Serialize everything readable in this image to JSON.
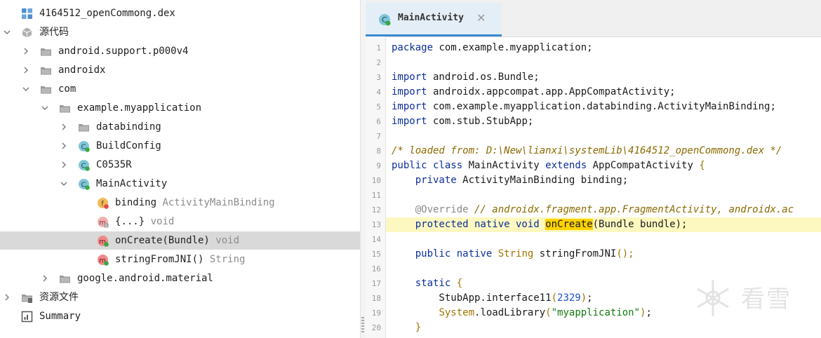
{
  "tree": {
    "items": [
      {
        "label": "4164512_openCommong.dex",
        "type": "",
        "icon": "dex-file-icon",
        "depth": 0,
        "expand": "none",
        "selected": false
      },
      {
        "label": "源代码",
        "type": "",
        "icon": "package-cube-icon",
        "depth": 0,
        "expand": "expanded",
        "selected": false
      },
      {
        "label": "android.support.p000v4",
        "type": "",
        "icon": "folder-icon",
        "depth": 1,
        "expand": "collapsed",
        "selected": false
      },
      {
        "label": "androidx",
        "type": "",
        "icon": "folder-icon",
        "depth": 1,
        "expand": "collapsed",
        "selected": false
      },
      {
        "label": "com",
        "type": "",
        "icon": "folder-icon",
        "depth": 1,
        "expand": "expanded",
        "selected": false
      },
      {
        "label": "example.myapplication",
        "type": "",
        "icon": "folder-icon",
        "depth": 2,
        "expand": "expanded",
        "selected": false
      },
      {
        "label": "databinding",
        "type": "",
        "icon": "folder-icon",
        "depth": 3,
        "expand": "collapsed",
        "selected": false
      },
      {
        "label": "BuildConfig",
        "type": "",
        "icon": "class-icon",
        "depth": 3,
        "expand": "collapsed",
        "selected": false
      },
      {
        "label": "C0535R",
        "type": "",
        "icon": "class-icon",
        "depth": 3,
        "expand": "collapsed",
        "selected": false
      },
      {
        "label": "MainActivity",
        "type": "",
        "icon": "class-icon",
        "depth": 3,
        "expand": "expanded",
        "selected": false
      },
      {
        "label": "binding",
        "type": "ActivityMainBinding",
        "icon": "field-icon",
        "depth": 4,
        "expand": "none",
        "selected": false
      },
      {
        "label": "{...}",
        "type": "void",
        "icon": "static-method-icon",
        "depth": 4,
        "expand": "none",
        "selected": false
      },
      {
        "label": "onCreate(Bundle)",
        "type": "void",
        "icon": "method-icon",
        "depth": 4,
        "expand": "none",
        "selected": true
      },
      {
        "label": "stringFromJNI()",
        "type": "String",
        "icon": "method-icon",
        "depth": 4,
        "expand": "none",
        "selected": false
      },
      {
        "label": "google.android.material",
        "type": "",
        "icon": "folder-icon",
        "depth": 2,
        "expand": "collapsed",
        "selected": false
      },
      {
        "label": "资源文件",
        "type": "",
        "icon": "resources-folder-icon",
        "depth": 0,
        "expand": "collapsed",
        "selected": false
      },
      {
        "label": "Summary",
        "type": "",
        "icon": "summary-icon",
        "depth": 0,
        "expand": "none",
        "selected": false
      }
    ]
  },
  "editor": {
    "tab": {
      "label": "MainActivity",
      "close_glyph": "✕",
      "icon": "class-icon"
    },
    "highlight_line": 13,
    "lines": [
      {
        "n": "1",
        "tokens": [
          {
            "t": "package",
            "c": "kw"
          },
          {
            "t": " com.example.myapplication;",
            "c": ""
          }
        ]
      },
      {
        "n": "2",
        "tokens": []
      },
      {
        "n": "3",
        "tokens": [
          {
            "t": "import",
            "c": "kw"
          },
          {
            "t": " android.os.Bundle;",
            "c": ""
          }
        ]
      },
      {
        "n": "4",
        "tokens": [
          {
            "t": "import",
            "c": "kw"
          },
          {
            "t": " androidx.appcompat.app.AppCompatActivity;",
            "c": ""
          }
        ]
      },
      {
        "n": "5",
        "tokens": [
          {
            "t": "import",
            "c": "kw"
          },
          {
            "t": " com.example.myapplication.databinding.ActivityMainBinding;",
            "c": ""
          }
        ]
      },
      {
        "n": "6",
        "tokens": [
          {
            "t": "import",
            "c": "kw"
          },
          {
            "t": " com.stub.StubApp;",
            "c": ""
          }
        ]
      },
      {
        "n": "7",
        "tokens": []
      },
      {
        "n": "8",
        "tokens": [
          {
            "t": "/* loaded from: D:\\New\\lianxi\\systemLib\\4164512_openCommong.dex */",
            "c": "cm"
          }
        ]
      },
      {
        "n": "9",
        "tokens": [
          {
            "t": "public class",
            "c": "kw"
          },
          {
            "t": " MainActivity ",
            "c": ""
          },
          {
            "t": "extends",
            "c": "kw"
          },
          {
            "t": " AppCompatActivity ",
            "c": ""
          },
          {
            "t": "{",
            "c": "ty"
          }
        ]
      },
      {
        "n": "10",
        "tokens": [
          {
            "t": "    ",
            "c": ""
          },
          {
            "t": "private",
            "c": "kw"
          },
          {
            "t": " ActivityMainBinding binding;",
            "c": ""
          }
        ]
      },
      {
        "n": "11",
        "tokens": []
      },
      {
        "n": "12",
        "tokens": [
          {
            "t": "    ",
            "c": ""
          },
          {
            "t": "@Override",
            "c": "an"
          },
          {
            "t": " // androidx.fragment.app.FragmentActivity, androidx.ac",
            "c": "cm"
          }
        ]
      },
      {
        "n": "13",
        "tokens": [
          {
            "t": "    ",
            "c": ""
          },
          {
            "t": "protected native void",
            "c": "kw"
          },
          {
            "t": " ",
            "c": ""
          },
          {
            "t": "onCreate",
            "c": "occ"
          },
          {
            "t": "(Bundle bundle);",
            "c": ""
          }
        ]
      },
      {
        "n": "14",
        "tokens": []
      },
      {
        "n": "15",
        "tokens": [
          {
            "t": "    ",
            "c": ""
          },
          {
            "t": "public native",
            "c": "kw"
          },
          {
            "t": " ",
            "c": ""
          },
          {
            "t": "String",
            "c": "ty"
          },
          {
            "t": " stringFromJNI",
            "c": ""
          },
          {
            "t": "();",
            "c": "ty"
          }
        ]
      },
      {
        "n": "16",
        "tokens": []
      },
      {
        "n": "17",
        "tokens": [
          {
            "t": "    ",
            "c": ""
          },
          {
            "t": "static",
            "c": "kw"
          },
          {
            "t": " ",
            "c": ""
          },
          {
            "t": "{",
            "c": "ty"
          }
        ]
      },
      {
        "n": "18",
        "tokens": [
          {
            "t": "        StubApp.interface11",
            "c": ""
          },
          {
            "t": "(",
            "c": "ty"
          },
          {
            "t": "2329",
            "c": "nm"
          },
          {
            "t": ")",
            "c": "ty"
          },
          {
            "t": ";",
            "c": ""
          }
        ]
      },
      {
        "n": "19",
        "tokens": [
          {
            "t": "        ",
            "c": ""
          },
          {
            "t": "System",
            "c": "ty"
          },
          {
            "t": ".loadLibrary",
            "c": ""
          },
          {
            "t": "(",
            "c": "ty"
          },
          {
            "t": "\"myapplication\"",
            "c": "st"
          },
          {
            "t": ")",
            "c": "ty"
          },
          {
            "t": ";",
            "c": ""
          }
        ]
      },
      {
        "n": "20",
        "tokens": [
          {
            "t": "    ",
            "c": ""
          },
          {
            "t": "}",
            "c": "ty"
          }
        ]
      }
    ]
  },
  "watermark": {
    "text": "看雪",
    "icon": "snowflake-icon"
  },
  "colors": {
    "accent": "#3c89d0",
    "selection": "#d9d9d9",
    "line_highlight": "#fdf8c0",
    "occurrence": "#ffd200"
  }
}
